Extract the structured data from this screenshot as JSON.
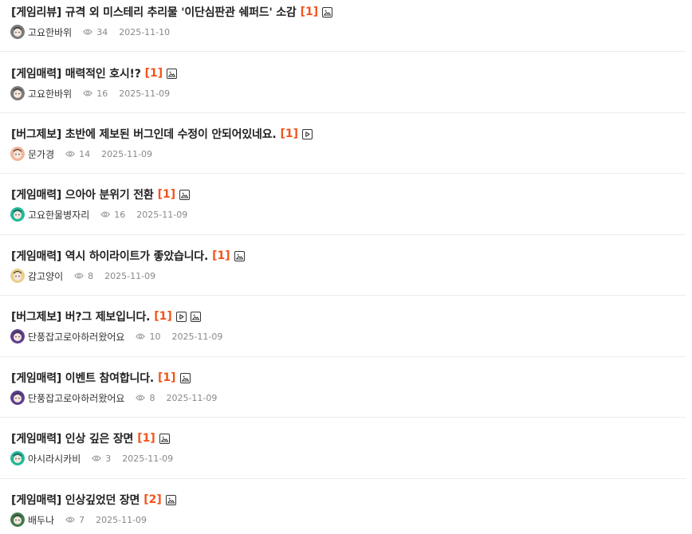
{
  "posts": [
    {
      "title": "[게임리뷰] 규격 외 미스테리 추리물 '이단심판관 쉐퍼드' 소감",
      "comments": "[1]",
      "attachments": [
        "image-icon"
      ],
      "author": "고요한바위",
      "avatar_color": "#7a7a7a",
      "views": "34",
      "date": "2025-11-10"
    },
    {
      "title": "[게임매력] 매력적인 호시!?",
      "comments": "[1]",
      "attachments": [
        "image-icon"
      ],
      "author": "고요한바위",
      "avatar_color": "#7a7a7a",
      "views": "16",
      "date": "2025-11-09"
    },
    {
      "title": "[버그제보] 초반에 제보된 버그인데 수정이 안되어있네요.",
      "comments": "[1]",
      "attachments": [
        "video-icon"
      ],
      "author": "문가경",
      "avatar_color": "#f2b49a",
      "views": "14",
      "date": "2025-11-09"
    },
    {
      "title": "[게임매력] 으아아 분위기 전환",
      "comments": "[1]",
      "attachments": [
        "image-icon"
      ],
      "author": "고요한물병자리",
      "avatar_color": "#1fb89a",
      "views": "16",
      "date": "2025-11-09"
    },
    {
      "title": "[게임매력] 역시 하이라이트가 좋았습니다.",
      "comments": "[1]",
      "attachments": [
        "image-icon"
      ],
      "author": "감고양이",
      "avatar_color": "#e8cf8a",
      "views": "8",
      "date": "2025-11-09"
    },
    {
      "title": "[버그제보] 버?그 제보입니다.",
      "comments": "[1]",
      "attachments": [
        "video-icon",
        "image-icon"
      ],
      "author": "단풍잡고로아하러왔어요",
      "avatar_color": "#5b3f8c",
      "views": "10",
      "date": "2025-11-09"
    },
    {
      "title": "[게임매력] 이벤트 참여합니다.",
      "comments": "[1]",
      "attachments": [
        "image-icon"
      ],
      "author": "단풍잡고로아하러왔어요",
      "avatar_color": "#5b3f8c",
      "views": "8",
      "date": "2025-11-09"
    },
    {
      "title": "[게임매력] 인상 깊은 장면",
      "comments": "[1]",
      "attachments": [
        "image-icon"
      ],
      "author": "아시라시카비",
      "avatar_color": "#1fb89a",
      "views": "3",
      "date": "2025-11-09"
    },
    {
      "title": "[게임매력] 인상깊었던 장면",
      "comments": "[2]",
      "attachments": [
        "image-icon"
      ],
      "author": "배두나",
      "avatar_color": "#3f7a4a",
      "views": "7",
      "date": "2025-11-09"
    }
  ]
}
